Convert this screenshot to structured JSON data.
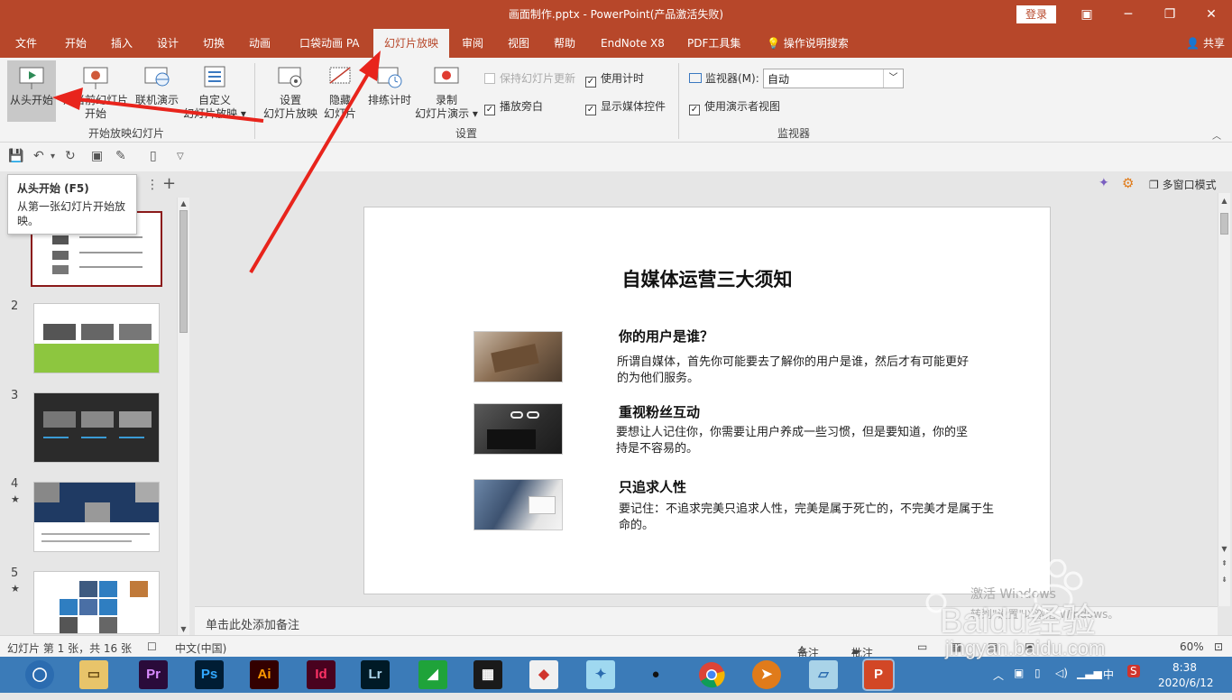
{
  "window": {
    "title": "画面制作.pptx  -  PowerPoint(产品激活失败)",
    "login_label": "登录",
    "share_label": "共享"
  },
  "tabs": [
    {
      "label": "文件"
    },
    {
      "label": "开始"
    },
    {
      "label": "插入"
    },
    {
      "label": "设计"
    },
    {
      "label": "切换"
    },
    {
      "label": "动画"
    },
    {
      "label": "口袋动画 PA"
    },
    {
      "label": "幻灯片放映",
      "active": true
    },
    {
      "label": "审阅"
    },
    {
      "label": "视图"
    },
    {
      "label": "帮助"
    },
    {
      "label": "EndNote X8"
    },
    {
      "label": "PDF工具集"
    },
    {
      "label": "操作说明搜索"
    }
  ],
  "ribbon": {
    "start_group": {
      "from_beginning": "从头开始",
      "from_current_1": "从当前幻灯片",
      "from_current_2": "开始",
      "online_present": "联机演示",
      "custom_1": "自定义",
      "custom_2": "幻灯片放映",
      "group_label": "开始放映幻灯片"
    },
    "setup_group": {
      "setup_1": "设置",
      "setup_2": "幻灯片放映",
      "hide_1": "隐藏",
      "hide_2": "幻灯片",
      "rehearse": "排练计时",
      "record_1": "录制",
      "record_2": "幻灯片演示",
      "keep_updated": "保持幻灯片更新",
      "use_timings": "使用计时",
      "play_narrations": "播放旁白",
      "show_media": "显示媒体控件",
      "group_label": "设置"
    },
    "monitor_group": {
      "monitor_label": "监视器(M):",
      "monitor_value": "自动",
      "presenter_view": "使用演示者视图",
      "group_label": "监视器"
    }
  },
  "tooltip": {
    "title": "从头开始 (F5)",
    "desc": "从第一张幻灯片开始放映。"
  },
  "thumbnails": [
    {
      "num": "2",
      "star": ""
    },
    {
      "num": "3",
      "star": ""
    },
    {
      "num": "4",
      "star": "★"
    },
    {
      "num": "5",
      "star": "★"
    }
  ],
  "slide": {
    "title": "自媒体运营三大须知",
    "items": [
      {
        "heading": "你的用户是谁？",
        "body": "所谓自媒体，首先你可能要去了解你的用户是谁，然后才有可能更好的为他们服务。"
      },
      {
        "heading": "重视粉丝互动",
        "body": "要想让人记住你，你需要让用户养成一些习惯，但是要知道，你的坚持是不容易的。"
      },
      {
        "heading": "只追求人性",
        "body": "要记住：不追求完美只追求人性，完美是属于死亡的，不完美才是属于生命的。"
      }
    ]
  },
  "view": {
    "multiwindow": "多窗口模式"
  },
  "notes_placeholder": "单击此处添加备注",
  "status": {
    "slide_info": "幻灯片 第 1 张，共 16 张",
    "language": "中文(中国)",
    "notes": "备注",
    "comments": "批注",
    "zoom": "60%"
  },
  "taskbar": {
    "apps": [
      "Pr",
      "Ps",
      "Ai",
      "Id",
      "Lr"
    ],
    "ime": "中",
    "time": "8:38",
    "date": "2020/6/12"
  },
  "watermark": {
    "brand": "Baidu经验",
    "url": "jingyan.baidu.com",
    "activate_1": "激活 Windows",
    "activate_2": "转到\"设置\"以激活 Windows。"
  },
  "colors": {
    "accent": "#b7472a",
    "taskbar": "#3b7bb8",
    "arrow": "#e8241c"
  }
}
